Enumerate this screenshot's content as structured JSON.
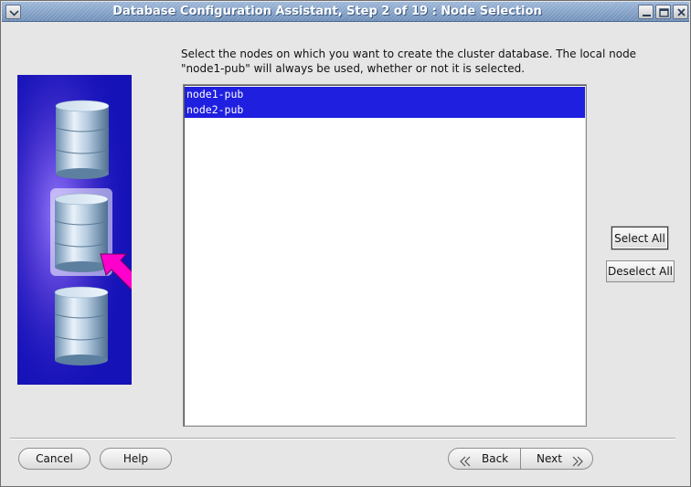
{
  "window": {
    "title": "Database Configuration Assistant, Step 2 of 19 : Node Selection"
  },
  "instruction": "Select the nodes on which you want to create the cluster database. The local node \"node1-pub\" will always be used, whether or not it is selected.",
  "node_list": {
    "items": [
      {
        "label": "node1-pub",
        "selected": true
      },
      {
        "label": "node2-pub",
        "selected": true
      }
    ]
  },
  "buttons": {
    "select_all": "Select All",
    "deselect_all": "Deselect All",
    "cancel": "Cancel",
    "help": "Help",
    "back": "Back",
    "next": "Next"
  },
  "colors": {
    "selection": "#1f1fe0",
    "side_panel": "#1512b8",
    "highlight_arrow": "#ff00cc"
  },
  "icons": {
    "side_image": "database-cylinders-with-arrow",
    "back": "double-chevron-left-icon",
    "next": "double-chevron-right-icon"
  }
}
